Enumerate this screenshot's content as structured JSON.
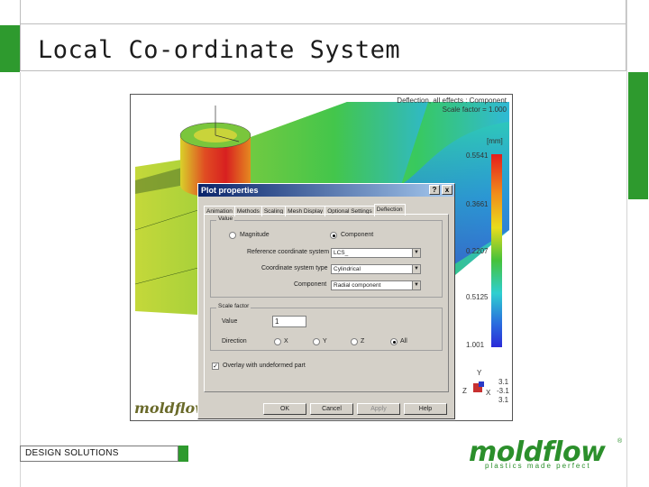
{
  "slide": {
    "title": "Local Co-ordinate System",
    "footer_text": "DESIGN SOLUTIONS",
    "logo_text": "moldflow",
    "logo_tagline": "plastics made perfect",
    "logo_reg": "®"
  },
  "result_view": {
    "legend_title_line1": "Deflection, all effects : Component",
    "legend_title_line2": "Scale factor = 1.000",
    "unit": "[mm]",
    "scale_ticks": [
      "0.5541",
      "0.3661",
      "0.2207",
      "0.5125",
      "1.001"
    ],
    "axis_labels": {
      "top": "Y",
      "r1": "3.1",
      "r2": "-3.1",
      "r3": "3.1",
      "side": "Z",
      "x": "X"
    },
    "watermark": "moldflow"
  },
  "dialog": {
    "title": "Plot properties",
    "help_btn": "?",
    "close_btn": "x",
    "tabs": [
      "Animation",
      "Methods",
      "Scaling",
      "Mesh Display",
      "Optional Settings",
      "Deflection"
    ],
    "active_tab": "Deflection",
    "value_group": {
      "label": "Value",
      "magnitude_label": "Magnitude",
      "component_label": "Component",
      "ref_coord_label": "Reference coordinate system",
      "ref_coord_value": "LCS_",
      "coord_type_label": "Coordinate system type",
      "coord_type_value": "Cylindrical",
      "component_field_label": "Component",
      "component_value": "Radial component"
    },
    "scale_group": {
      "label": "Scale factor",
      "value_label": "Value",
      "value": "1",
      "direction_label": "Direction",
      "dir_x": "X",
      "dir_y": "Y",
      "dir_z": "Z",
      "dir_all": "All"
    },
    "overlay_label": "Overlay with undeformed part",
    "buttons": {
      "ok": "OK",
      "cancel": "Cancel",
      "apply": "Apply",
      "help": "Help"
    }
  }
}
